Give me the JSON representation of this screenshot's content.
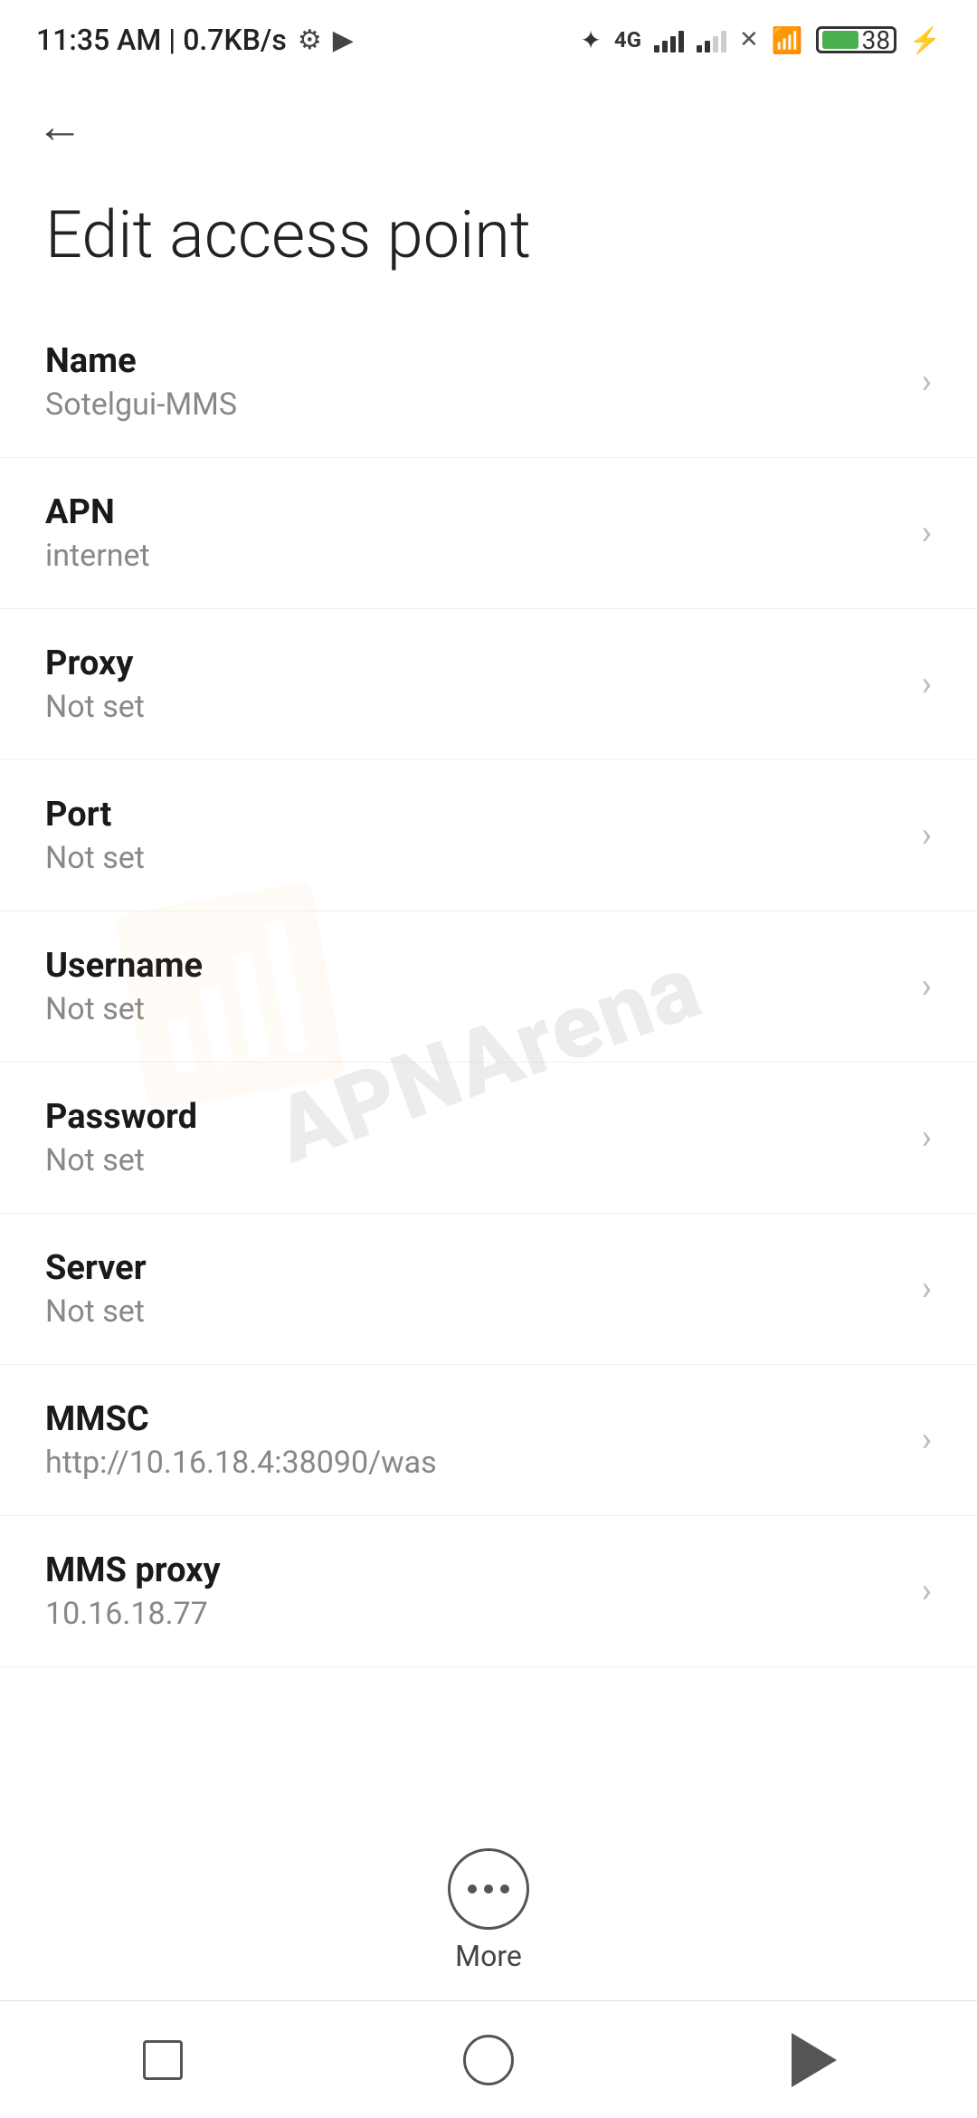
{
  "statusBar": {
    "time": "11:35 AM | 0.7KB/s",
    "battery": "38"
  },
  "toolbar": {
    "backLabel": "←"
  },
  "page": {
    "title": "Edit access point"
  },
  "settings": [
    {
      "label": "Name",
      "value": "Sotelgui-MMS"
    },
    {
      "label": "APN",
      "value": "internet"
    },
    {
      "label": "Proxy",
      "value": "Not set"
    },
    {
      "label": "Port",
      "value": "Not set"
    },
    {
      "label": "Username",
      "value": "Not set"
    },
    {
      "label": "Password",
      "value": "Not set"
    },
    {
      "label": "Server",
      "value": "Not set"
    },
    {
      "label": "MMSC",
      "value": "http://10.16.18.4:38090/was"
    },
    {
      "label": "MMS proxy",
      "value": "10.16.18.77"
    }
  ],
  "more": {
    "label": "More"
  },
  "watermark": "APNArena"
}
